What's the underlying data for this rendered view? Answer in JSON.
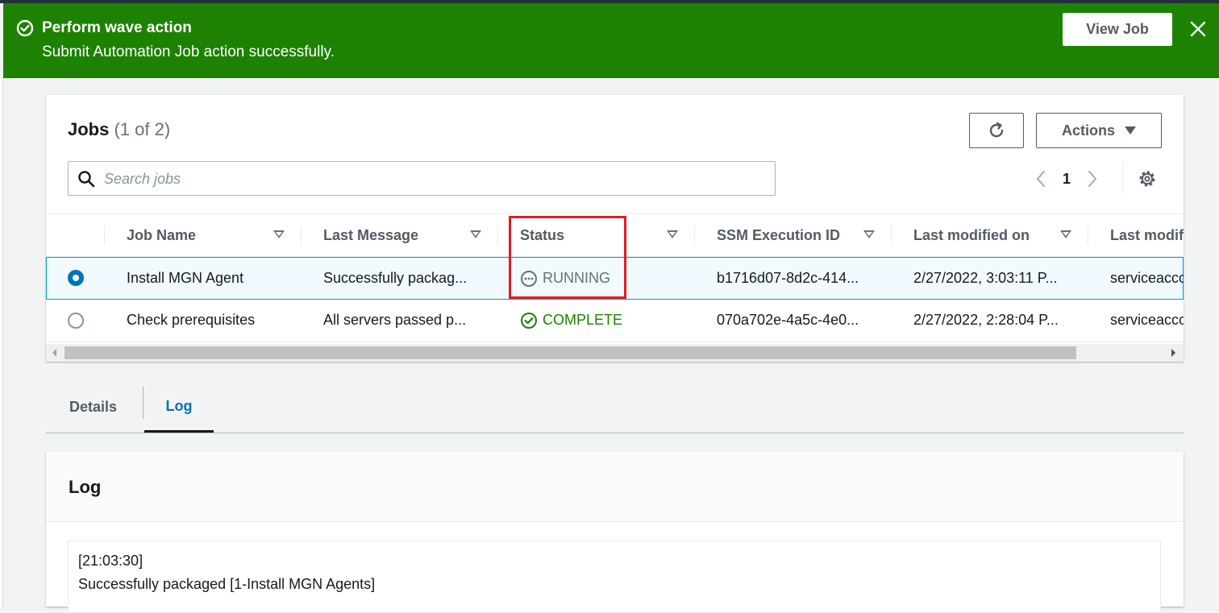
{
  "flash": {
    "title": "Perform wave action",
    "message": "Submit Automation Job action successfully.",
    "view_button": "View Job",
    "color": "#1d8102"
  },
  "jobs": {
    "title": "Jobs",
    "count": "(1 of 2)",
    "actions_label": "Actions",
    "search_placeholder": "Search jobs",
    "page": "1",
    "columns": [
      "Job Name",
      "Last Message",
      "Status",
      "SSM Execution ID",
      "Last modified on",
      "Last modifi"
    ],
    "rows": [
      {
        "selected": true,
        "job_name": "Install MGN Agent",
        "last_message": "Successfully packag...",
        "status": "RUNNING",
        "ssm_id": "b1716d07-8d2c-414...",
        "modified_on": "2/27/2022, 3:03:11 P...",
        "modified_by": "serviceacco"
      },
      {
        "selected": false,
        "job_name": "Check prerequisites",
        "last_message": "All servers passed p...",
        "status": "COMPLETE",
        "ssm_id": "070a702e-4a5c-4e0...",
        "modified_on": "2/27/2022, 2:28:04 P...",
        "modified_by": "serviceacco"
      }
    ]
  },
  "tabs": [
    "Details",
    "Log"
  ],
  "active_tab": "Log",
  "log": {
    "title": "Log",
    "lines": [
      "[21:03:30]",
      "Successfully packaged [1-Install MGN Agents]"
    ]
  },
  "icons": {
    "flash": "check-circle-icon",
    "close": "close-icon",
    "refresh": "refresh-icon",
    "search": "search-icon",
    "settings": "gear-icon"
  },
  "colors": {
    "success": "#1d8102",
    "link": "#0073bb",
    "running": "#687078",
    "highlight": "#e31b23"
  }
}
